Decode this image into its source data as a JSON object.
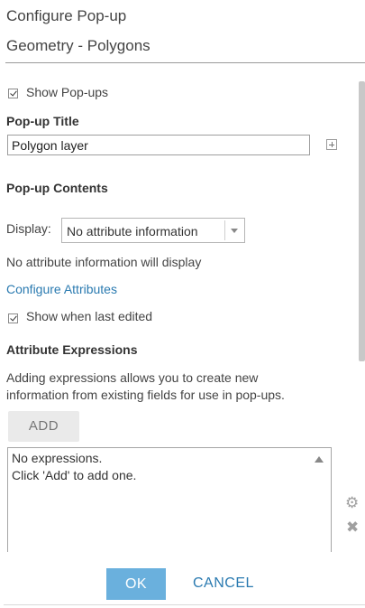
{
  "header": {
    "title": "Configure Pop-up",
    "subtitle": "Geometry - Polygons"
  },
  "show_popups": {
    "label": "Show Pop-ups",
    "checked": true
  },
  "popup_title": {
    "heading": "Pop-up Title",
    "value": "Polygon layer"
  },
  "popup_contents": {
    "heading": "Pop-up Contents",
    "display_label": "Display:",
    "display_value": "No attribute information",
    "info_text": "No attribute information will display",
    "configure_link": "Configure Attributes",
    "show_last_edited": {
      "label": "Show when last edited",
      "checked": true
    }
  },
  "attribute_expressions": {
    "heading": "Attribute Expressions",
    "description_line1": "Adding expressions allows you to create new",
    "description_line2": "information from existing fields for use in pop-ups.",
    "add_label": "ADD",
    "empty_line1": "No expressions.",
    "empty_line2": "Click 'Add' to add one."
  },
  "icons": {
    "add_title_field": "plus-box-icon",
    "expression_settings": "gear-icon",
    "expression_delete": "delete-x-icon",
    "dropdown": "chevron-down-icon"
  },
  "footer": {
    "ok_label": "OK",
    "cancel_label": "CANCEL"
  },
  "colors": {
    "accent": "#6ab0dd",
    "link": "#2a7ab0"
  }
}
